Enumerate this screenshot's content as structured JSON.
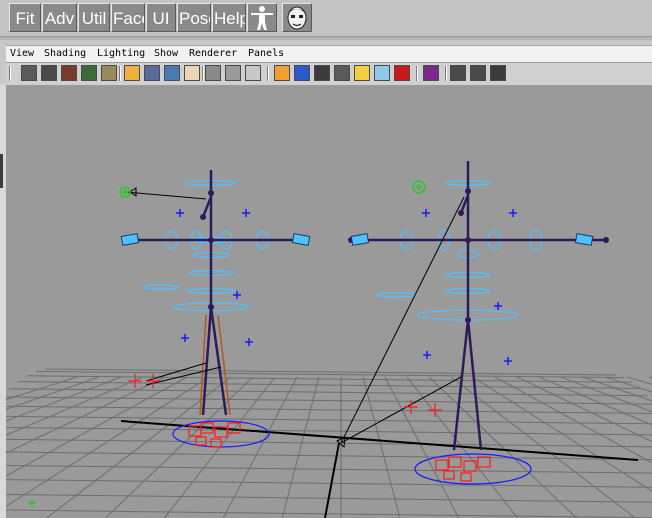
{
  "shelf": {
    "buttons": [
      "Fit",
      "Adv",
      "Util",
      "Face",
      "UI",
      "Pose",
      "Help"
    ],
    "icons": [
      "t-pose-figure-icon",
      "character-face-icon"
    ]
  },
  "panel": {
    "menu": [
      "View",
      "Shading",
      "Lighting",
      "Show",
      "Renderer",
      "Panels"
    ],
    "toolbar_icons": [
      "select-camera-icon",
      "camera-attributes-icon",
      "bookmarks-icon",
      "image-plane-icon",
      "2d-pan-zoom-icon",
      "grid-icon",
      "film-gate-icon",
      "resolution-gate-icon",
      "gate-mask-icon",
      "field-chart-icon",
      "safe-action-icon",
      "safe-title-icon",
      "isolate-select-icon",
      "wireframe-icon",
      "smooth-shade-icon",
      "flat-shade-icon",
      "use-lights-icon",
      "xray-icon",
      "textured-icon",
      "xray-joints-icon",
      "shadows-icon",
      "ambient-occlusion-icon",
      "motion-blur-icon"
    ]
  },
  "viewport": {
    "grid_color": "#6e6e6e",
    "axis_color": "#000000",
    "background": "#9a9a9a",
    "joint_color": "#2e1a5a",
    "control_color": "#4fc1ff",
    "ik_color": "#ff1a1a",
    "locator_color": "#1a1aff",
    "pole_color": "#22cc22",
    "skeleton_highlight": "#b35a1a"
  }
}
